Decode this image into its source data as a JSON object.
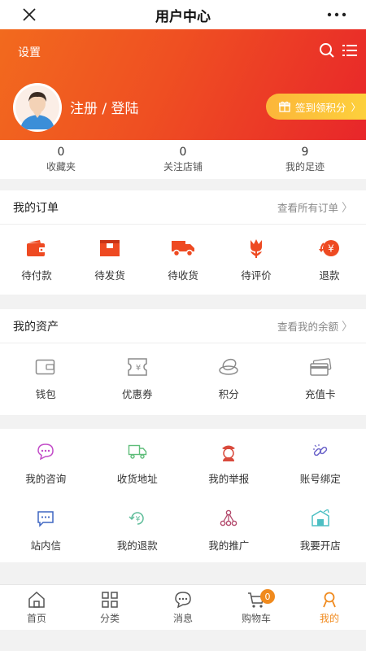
{
  "header": {
    "title": "用户中心"
  },
  "hero": {
    "settings_label": "设置",
    "login_label": "注册 / 登陆",
    "signin_label": "签到领积分"
  },
  "stats": [
    {
      "value": "0",
      "label": "收藏夹"
    },
    {
      "value": "0",
      "label": "关注店铺"
    },
    {
      "value": "9",
      "label": "我的足迹"
    }
  ],
  "orders": {
    "title": "我的订单",
    "link": "查看所有订单",
    "items": [
      {
        "label": "待付款",
        "icon": "wallet-icon"
      },
      {
        "label": "待发货",
        "icon": "box-icon"
      },
      {
        "label": "待收货",
        "icon": "truck-icon"
      },
      {
        "label": "待评价",
        "icon": "tulip-icon"
      },
      {
        "label": "退款",
        "icon": "refund-icon"
      }
    ]
  },
  "assets": {
    "title": "我的资产",
    "link": "查看我的余额",
    "items": [
      {
        "label": "钱包",
        "icon": "wallet-outline-icon"
      },
      {
        "label": "优惠券",
        "icon": "coupon-icon"
      },
      {
        "label": "积分",
        "icon": "coins-icon"
      },
      {
        "label": "充值卡",
        "icon": "card-icon"
      }
    ]
  },
  "services": {
    "items": [
      {
        "label": "我的咨询",
        "icon": "chat-icon"
      },
      {
        "label": "收货地址",
        "icon": "delivery-icon"
      },
      {
        "label": "我的举报",
        "icon": "officer-icon"
      },
      {
        "label": "账号绑定",
        "icon": "link-icon"
      },
      {
        "label": "站内信",
        "icon": "message-icon"
      },
      {
        "label": "我的退款",
        "icon": "refund-circle-icon"
      },
      {
        "label": "我的推广",
        "icon": "network-icon"
      },
      {
        "label": "我要开店",
        "icon": "shop-icon"
      }
    ]
  },
  "tabs": [
    {
      "label": "首页",
      "icon": "home-icon"
    },
    {
      "label": "分类",
      "icon": "grid-icon"
    },
    {
      "label": "消息",
      "icon": "chat-icon"
    },
    {
      "label": "购物车",
      "icon": "cart-icon",
      "badge": "0"
    },
    {
      "label": "我的",
      "icon": "user-icon",
      "active": true
    }
  ],
  "colors": {
    "accent": "#f08a1d",
    "hero_start": "#f26a1e",
    "hero_end": "#e8262a",
    "order_icon": "#ee4a22"
  }
}
